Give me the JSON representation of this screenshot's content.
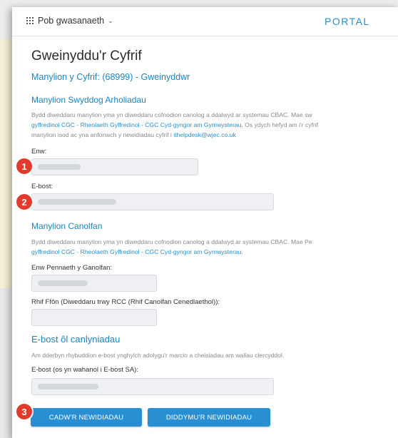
{
  "header": {
    "apps_menu_label": "Pob gwasanaeth",
    "portal_label": "PORTAL"
  },
  "page": {
    "title": "Gweinyddu'r Cyfrif",
    "account_details": "Manylion y Cyfrif: (68999) - Gweinyddwr"
  },
  "exam_officer": {
    "heading": "Manylion Swyddog Arholiadau",
    "para_line1": "Bydd diweddaru manylion yma yn diweddaru cofnodion canolog a ddalwyd ar systemau CBAC. Mae sw",
    "para_line2_link": "gyffredinol CGC - Rheolaeth Gyffredinol - CGC Cyd-gyngor am Gymwysterau.",
    "para_line2_rest": " Os ydych hefyd am i'r cyfrif",
    "para_line3_text": "manylion isod ac yna anfonwch y newidiadau cyfrif i ",
    "para_line3_email": "ithelpdesk@wjec.co.uk",
    "name_label": "Enw:",
    "email_label": "E-bost:"
  },
  "centre": {
    "heading": "Manylion Canolfan",
    "para_line1": "Bydd diweddaru manylion yma yn diweddaru cofnodion canolog a ddalwyd ar systemau CBAC. Mae Pe",
    "para_line2_link": "gyffredinol CGC - Rheolaeth Gyffredinol - CGC Cyd-gyngor am Gymwysterau.",
    "head_label": "Enw Pennaeth y Ganolfan:",
    "phone_label": "Rhif Ffôn (Diweddaru trwy RCC (Rhif Canolfan Cenedlaethol)):"
  },
  "results_email": {
    "heading": "E-bost ôl canlyniadau",
    "para": "Am dderbyn rhybuddion e-bost ynghylch adolygu'r marcio a cheisiadau am wallau clercyddol.",
    "email_label": "E-bost (os yn wahanol i E-bost SA):"
  },
  "buttons": {
    "save": "CADW'R NEWIDIADAU",
    "cancel": "DIDDYMU'R NEWIDIADAU"
  },
  "callouts": [
    "1",
    "2",
    "3"
  ],
  "colors": {
    "accent": "#2a8fd0",
    "callout": "#e23b2e"
  }
}
